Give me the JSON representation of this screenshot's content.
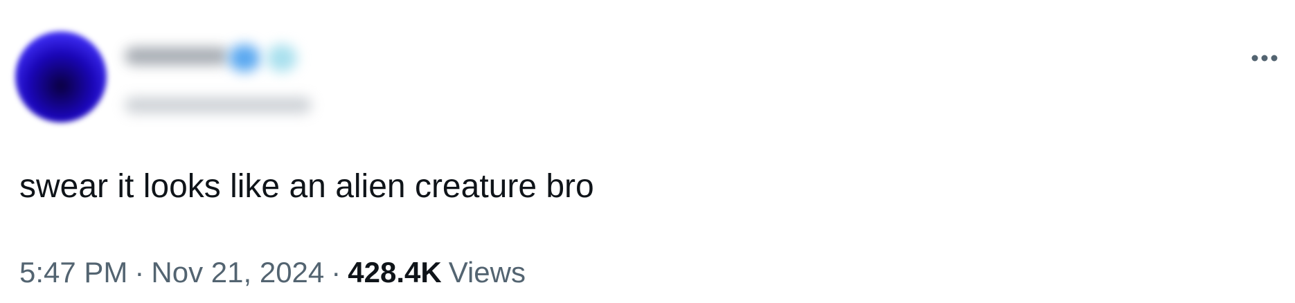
{
  "tweet": {
    "author": {
      "avatar_color": "#1a06b8",
      "name_blurred": true,
      "handle_blurred": true
    },
    "text": "swear it looks like an alien creature bro",
    "time": "5:47 PM",
    "separator": "·",
    "date": "Nov 21, 2024",
    "views_count": "428.4K",
    "views_label": "Views",
    "more_icon": "more-horizontal-icon"
  },
  "colors": {
    "text_primary": "#0f1419",
    "text_secondary": "#536471",
    "verified_badge": "#5aa8f0"
  }
}
